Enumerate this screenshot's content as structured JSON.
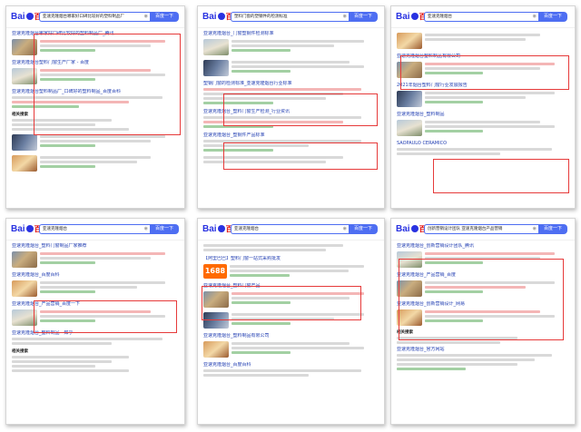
{
  "brand": {
    "logo_bai": "Bai",
    "logo_du": "百度"
  },
  "search_button": "百度一下",
  "panels": [
    {
      "query": "亚速克隆烟台哪家好口碑比较好的塑料制品厂"
    },
    {
      "query": "塑料门窗的塑钢件的检测标准"
    },
    {
      "query": "亚速克隆烟台"
    },
    {
      "query": "亚速克隆烟台"
    },
    {
      "query": "亚速克隆烟台"
    },
    {
      "query": "创新营销设计团队 亚速克隆烟台产品营销"
    }
  ],
  "result_titles": {
    "p1": [
      "亚速克隆烟台哪家好口碑比较好的塑料制品厂_腾讯",
      "亚速克隆烟台塑料门窗生产厂家 - 百度",
      "亚速克隆烟台塑料制品厂_口碑好的塑料制品_百度百科"
    ],
    "p2": [
      "亚速克隆烟台_门窗塑钢件检测标准",
      "塑钢门窗的检测标准_亚速克隆烟台行业标准",
      "亚速克隆烟台_塑料门窗生产检测_行业资讯",
      "亚速克隆烟台_塑钢件产品标准"
    ],
    "p3": [
      "亚速克隆烟台塑料制品有限公司",
      "2021年烟台塑料门窗行业发展报告",
      "亚速克隆烟台_塑料制品",
      "SAOPAULO CERAMICO"
    ],
    "p4": [
      "亚速克隆烟台_塑料门窗制品厂家推荐",
      "亚速克隆烟台_百度百科",
      "亚速克隆烟台_产品营销_百度一下",
      "亚速克隆烟台_塑料制品 - 知乎"
    ],
    "p5": [
      "【阿里巴巴】塑料门窗一站式采购批发",
      "亚速克隆烟台_塑料门窗产品",
      "亚速克隆烟台_塑料制品有限公司",
      "亚速克隆烟台_百度百科"
    ],
    "p6": [
      "亚速克隆烟台_创新营销设计团队_腾讯",
      "亚速克隆烟台_产品营销_百度",
      "亚速克隆烟台_创新营销设计_网易",
      "亚速克隆烟台_官方网站"
    ]
  },
  "labels": {
    "ad_1688": "1688",
    "related": "相关搜索",
    "ceramic": "SAOPAULO CERAMICO"
  },
  "colors": {
    "link": "#2440b3",
    "highlight_frame": "#e63a3a",
    "search_blue": "#4e6ef2",
    "brand_red": "#e10601"
  }
}
